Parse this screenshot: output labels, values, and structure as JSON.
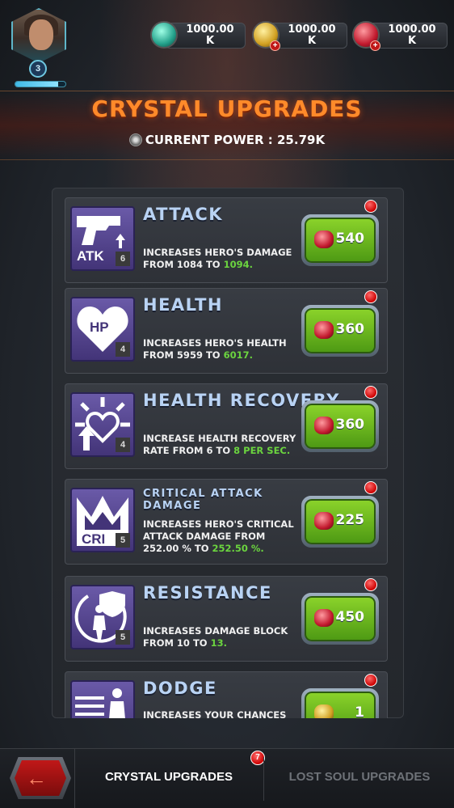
{
  "player": {
    "level": "3",
    "level_progress": 0.85
  },
  "currencies": [
    {
      "name": "teal-crystal",
      "amount": "1000.00",
      "unit": "K",
      "color": "#23a08a",
      "has_add": false
    },
    {
      "name": "gold-nugget",
      "amount": "1000.00",
      "unit": "K",
      "color": "#d1a022",
      "has_add": true
    },
    {
      "name": "red-crystal",
      "amount": "1000.00",
      "unit": "K",
      "color": "#c21a2e",
      "has_add": true
    }
  ],
  "header": {
    "title": "CRYSTAL UPGRADES",
    "power_label": "CURRENT POWER : 25.79K"
  },
  "upgrades": [
    {
      "name": "ATTACK",
      "level": "6",
      "icon_text": "ATK",
      "desc_line1": "INCREASES HERO'S DAMAGE",
      "desc_line2": "FROM 1084 TO ",
      "desc_highlight": "1094.",
      "cost": "540",
      "cost_currency": "red"
    },
    {
      "name": "HEALTH",
      "level": "4",
      "icon_text": "HP",
      "desc_line1": "INCREASES HERO'S HEALTH",
      "desc_line2": "FROM 5959 TO ",
      "desc_highlight": "6017.",
      "cost": "360",
      "cost_currency": "red"
    },
    {
      "name": "HEALTH RECOVERY",
      "level": "4",
      "icon_text": "",
      "desc_line1": "INCREASE HEALTH RECOVERY",
      "desc_line2": "RATE FROM 6 TO ",
      "desc_highlight": "8 PER SEC.",
      "cost": "360",
      "cost_currency": "red"
    },
    {
      "name": "CRITICAL ATTACK DAMAGE",
      "level": "5",
      "icon_text": "CRI",
      "desc_line1": "INCREASES HERO'S CRITICAL",
      "desc_line2": "ATTACK DAMAGE FROM",
      "desc_line3": "252.00 % TO ",
      "desc_highlight": "252.50 %.",
      "cost": "225",
      "cost_currency": "red"
    },
    {
      "name": "RESISTANCE",
      "level": "5",
      "icon_text": "",
      "desc_line1": "INCREASES DAMAGE BLOCK",
      "desc_line2": "FROM 10 TO ",
      "desc_highlight": "13.",
      "cost": "450",
      "cost_currency": "red"
    },
    {
      "name": "DODGE",
      "level": "",
      "icon_text": "",
      "desc_line1": "INCREASES YOUR CHANCES",
      "desc_line2": "",
      "desc_highlight": "",
      "cost": "1",
      "cost_currency": "gold"
    }
  ],
  "nav": {
    "back_label": "←",
    "tab_active": "CRYSTAL UPGRADES",
    "tab_inactive": "LOST SOUL UPGRADES",
    "tab_badge": "7"
  }
}
